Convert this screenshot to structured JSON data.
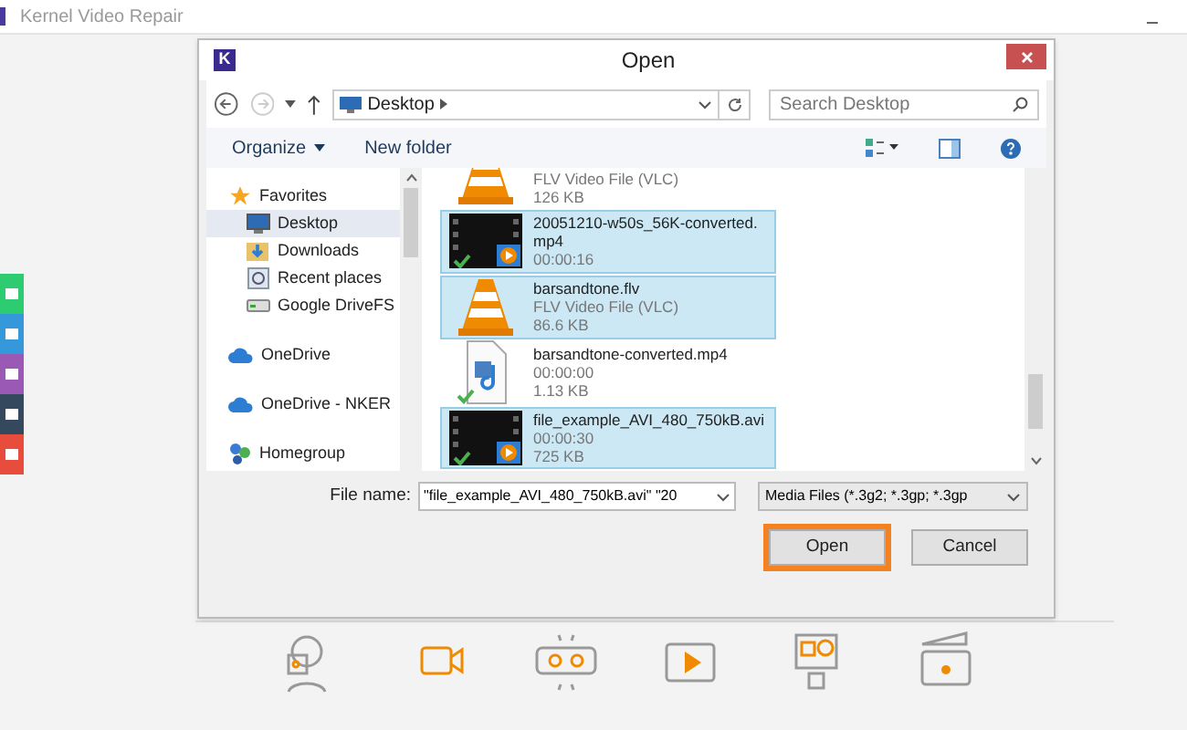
{
  "app": {
    "title": "Kernel Video Repair"
  },
  "side_tabs": [
    {
      "color": "#2ecc71"
    },
    {
      "color": "#3498db"
    },
    {
      "color": "#9b59b6"
    },
    {
      "color": "#34495e"
    },
    {
      "color": "#e74c3c"
    }
  ],
  "dialog": {
    "title": "Open",
    "logo": "K",
    "path": "Desktop",
    "search": {
      "placeholder": "Search Desktop"
    },
    "toolbar": [
      "Organize",
      "New folder"
    ],
    "nav": [
      {
        "label": "Favorites",
        "kind": "header",
        "selected": false
      },
      {
        "label": "Desktop",
        "kind": "desktop",
        "selected": true
      },
      {
        "label": "Downloads",
        "kind": "downloads",
        "selected": false
      },
      {
        "label": "Recent places",
        "kind": "recent",
        "selected": false
      },
      {
        "label": "Google DriveFS",
        "kind": "drive",
        "selected": false
      },
      {
        "label": "OneDrive",
        "kind": "cloud",
        "selected": false
      },
      {
        "label": "OneDrive - NKER",
        "kind": "cloud",
        "selected": false
      },
      {
        "label": "Homegroup",
        "kind": "homegroup",
        "selected": false
      }
    ],
    "files": [
      {
        "kind": "vlc",
        "lines": [
          "FLV Video File (VLC)",
          "126 KB"
        ],
        "selected": false
      },
      {
        "kind": "video",
        "name": "20051210-w50s_56K-converted.mp4",
        "lines": [
          "00:00:16"
        ],
        "selected": true
      },
      {
        "kind": "vlc",
        "name": "barsandtone.flv",
        "lines": [
          "FLV Video File (VLC)",
          "86.6 KB"
        ],
        "selected": true
      },
      {
        "kind": "audio",
        "name": "barsandtone-converted.mp4",
        "lines": [
          "00:00:00",
          "1.13 KB"
        ],
        "selected": false
      },
      {
        "kind": "video",
        "name": "file_example_AVI_480_750kB.avi",
        "lines": [
          "00:00:30",
          "725 KB"
        ],
        "selected": true
      }
    ],
    "file_name_label": "File name:",
    "file_name": "\"file_example_AVI_480_750kB.avi\" \"20",
    "file_type": "Media Files (*.3g2; *.3gp; *.3gp",
    "buttons": [
      {
        "label": "Open",
        "highlighted": true
      },
      {
        "label": "Cancel",
        "highlighted": false
      }
    ]
  }
}
